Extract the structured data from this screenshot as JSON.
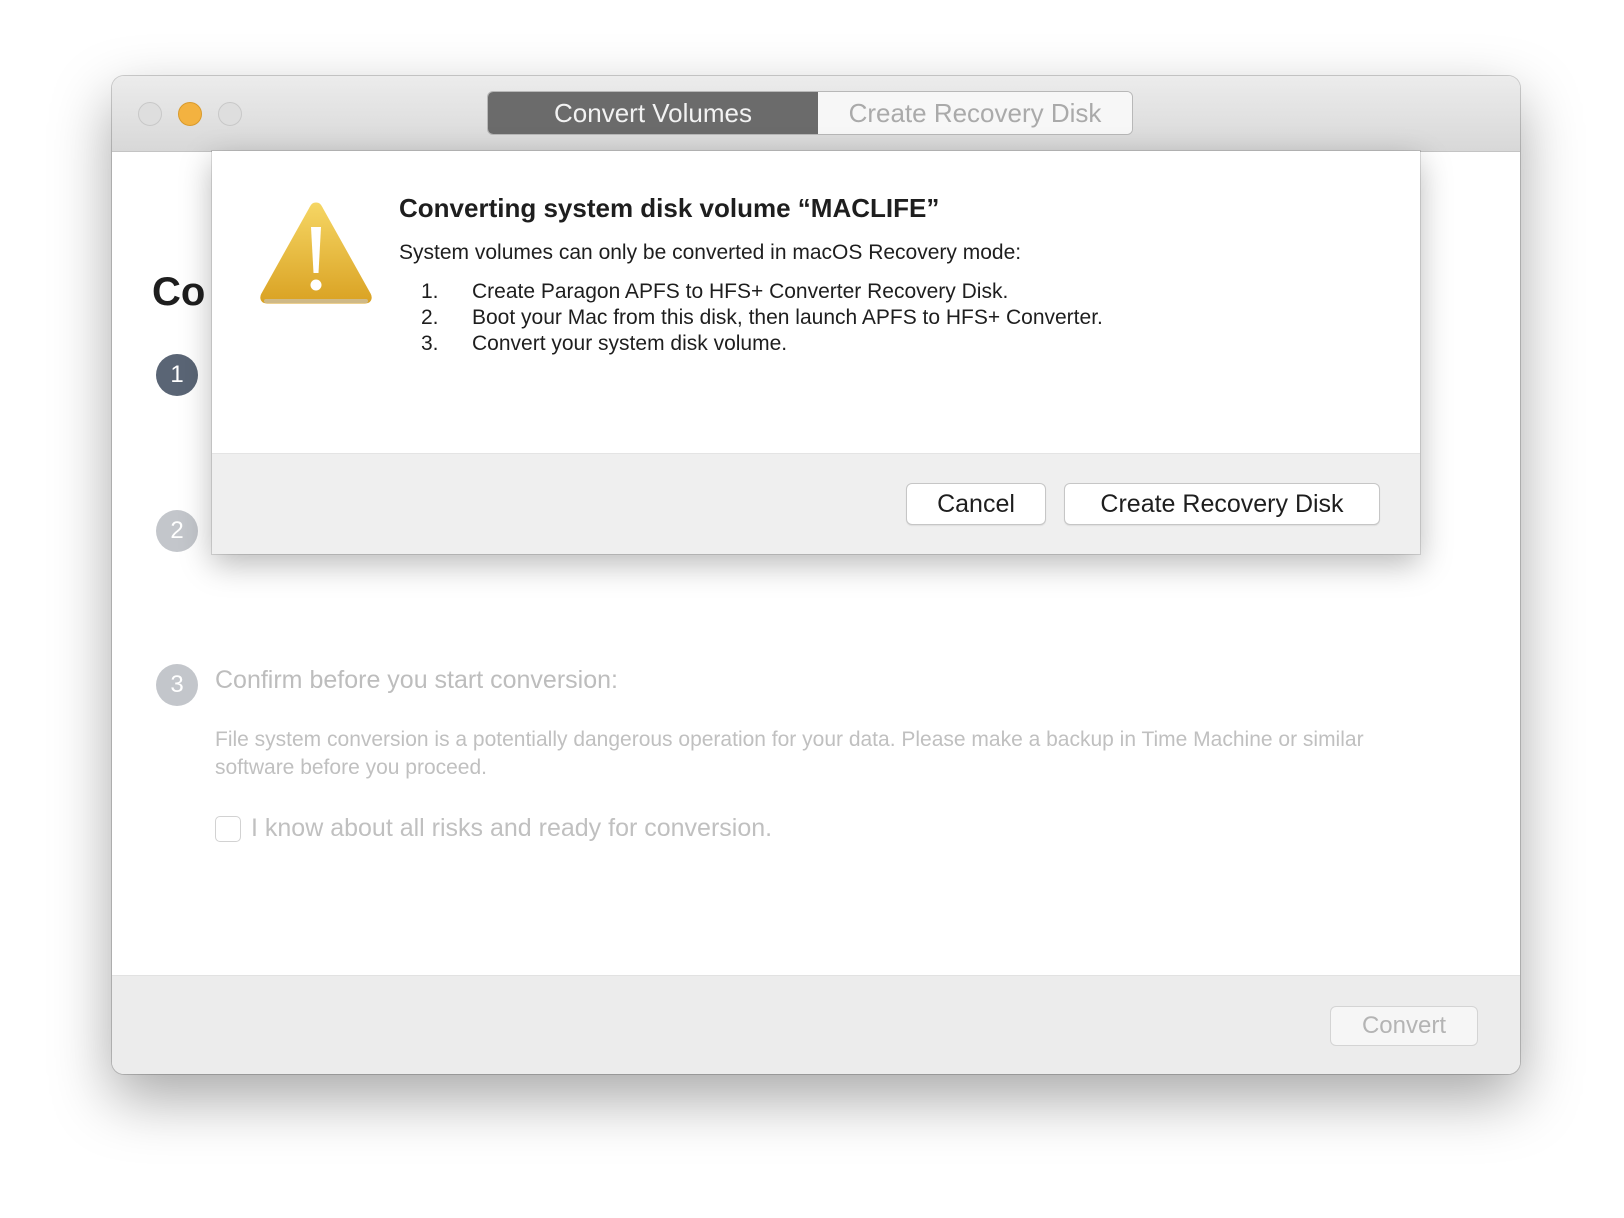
{
  "window": {
    "tabs": [
      {
        "label": "Convert Volumes",
        "active": true
      },
      {
        "label": "Create Recovery Disk",
        "active": false
      }
    ]
  },
  "main": {
    "partial_heading": "Co",
    "steps": [
      {
        "number": "1"
      },
      {
        "number": "2"
      },
      {
        "number": "3",
        "title": "Confirm before you start conversion:"
      }
    ],
    "warning_text": "File system conversion is a potentially dangerous operation for your data. Please make a backup in Time Machine or similar software before you proceed.",
    "risk_checkbox": {
      "label": "I know about all risks and ready for conversion.",
      "checked": false
    },
    "convert_button": "Convert"
  },
  "dialog": {
    "icon": "warning-icon",
    "title": "Converting system disk volume “MACLIFE”",
    "intro": "System volumes can only be converted in macOS Recovery mode:",
    "steps": [
      {
        "num": "1.",
        "text": "Create Paragon APFS to HFS+ Converter Recovery Disk."
      },
      {
        "num": "2.",
        "text": "Boot your Mac from this disk, then launch APFS to HFS+ Converter."
      },
      {
        "num": "3.",
        "text": "Convert your system disk volume."
      }
    ],
    "cancel_button": "Cancel",
    "create_button": "Create Recovery Disk"
  },
  "colors": {
    "active_tab": "#6b6b6b",
    "step_active": "#5a6575",
    "step_inactive": "#c3c6cb",
    "minimize": "#f3b240",
    "warning_yellow": "#e8b531"
  }
}
